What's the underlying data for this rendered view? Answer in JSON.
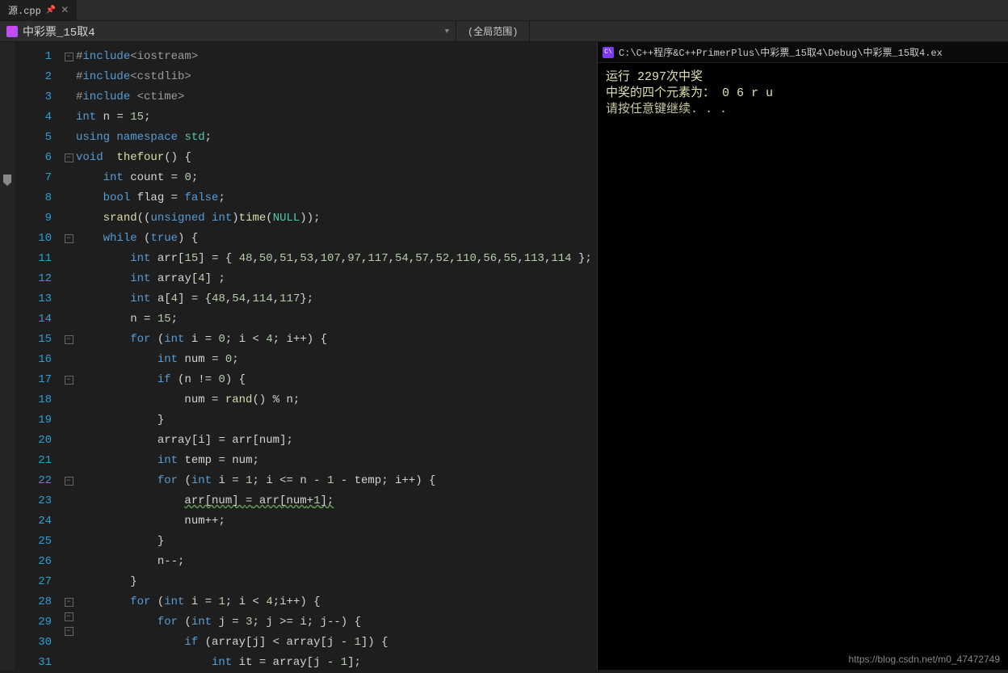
{
  "tab": {
    "label": "源.cpp"
  },
  "toolbar": {
    "project": "中彩票_15取4",
    "scope": "(全局范围)"
  },
  "console": {
    "title": "C:\\C++程序&C++PrimerPlus\\中彩票_15取4\\Debug\\中彩票_15取4.ex",
    "line1": "运行 2297次中奖",
    "line2": "中奖的四个元素为：  0 6 r u",
    "line3": "请按任意键继续. . ."
  },
  "watermark": "https://blog.csdn.net/m0_47472749",
  "gutter": {
    "start": 1,
    "end": 31,
    "highlighted": 15
  },
  "code": [
    {
      "n": 1,
      "fold": "-",
      "t": [
        [
          "pp",
          "#"
        ],
        [
          "ppk",
          "include"
        ],
        [
          "pp",
          "<iostream>"
        ]
      ]
    },
    {
      "n": 2,
      "t": [
        [
          "pp",
          "#"
        ],
        [
          "ppk",
          "include"
        ],
        [
          "pp",
          "<cstdlib>"
        ]
      ]
    },
    {
      "n": 3,
      "t": [
        [
          "pp",
          "#"
        ],
        [
          "ppk",
          "include"
        ],
        [
          "pp",
          " <ctime>"
        ]
      ]
    },
    {
      "n": 4,
      "t": [
        [
          "type",
          "int"
        ],
        [
          "id",
          " n "
        ],
        [
          "op",
          "="
        ],
        [
          "id",
          " "
        ],
        [
          "num",
          "15"
        ],
        [
          "op",
          ";"
        ]
      ]
    },
    {
      "n": 5,
      "t": [
        [
          "kw",
          "using namespace"
        ],
        [
          "id",
          " "
        ],
        [
          "cls",
          "std"
        ],
        [
          "op",
          ";"
        ]
      ]
    },
    {
      "n": 6,
      "fold": "-",
      "t": [
        [
          "type",
          "void"
        ],
        [
          "id",
          "  "
        ],
        [
          "func",
          "thefour"
        ],
        [
          "op",
          "() {"
        ]
      ]
    },
    {
      "n": 7,
      "indent": 1,
      "t": [
        [
          "type",
          "int"
        ],
        [
          "id",
          " count "
        ],
        [
          "op",
          "="
        ],
        [
          "id",
          " "
        ],
        [
          "num",
          "0"
        ],
        [
          "op",
          ";"
        ]
      ]
    },
    {
      "n": 8,
      "indent": 1,
      "t": [
        [
          "type",
          "bool"
        ],
        [
          "id",
          " flag "
        ],
        [
          "op",
          "="
        ],
        [
          "id",
          " "
        ],
        [
          "kw",
          "false"
        ],
        [
          "op",
          ";"
        ]
      ]
    },
    {
      "n": 9,
      "indent": 1,
      "t": [
        [
          "func",
          "srand"
        ],
        [
          "op",
          "(("
        ],
        [
          "type",
          "unsigned int"
        ],
        [
          "op",
          ")"
        ],
        [
          "func",
          "time"
        ],
        [
          "op",
          "("
        ],
        [
          "cls",
          "NULL"
        ],
        [
          "op",
          "));"
        ]
      ]
    },
    {
      "n": 10,
      "fold": "-",
      "indent": 1,
      "t": [
        [
          "kw",
          "while"
        ],
        [
          "op",
          " ("
        ],
        [
          "kw",
          "true"
        ],
        [
          "op",
          ") {"
        ]
      ]
    },
    {
      "n": 11,
      "indent": 2,
      "t": [
        [
          "type",
          "int"
        ],
        [
          "id",
          " arr["
        ],
        [
          "num",
          "15"
        ],
        [
          "id",
          "] "
        ],
        [
          "op",
          "= { "
        ],
        [
          "num",
          "48"
        ],
        [
          "op",
          ","
        ],
        [
          "num",
          "50"
        ],
        [
          "op",
          ","
        ],
        [
          "num",
          "51"
        ],
        [
          "op",
          ","
        ],
        [
          "num",
          "53"
        ],
        [
          "op",
          ","
        ],
        [
          "num",
          "107"
        ],
        [
          "op",
          ","
        ],
        [
          "num",
          "97"
        ],
        [
          "op",
          ","
        ],
        [
          "num",
          "117"
        ],
        [
          "op",
          ","
        ],
        [
          "num",
          "54"
        ],
        [
          "op",
          ","
        ],
        [
          "num",
          "57"
        ],
        [
          "op",
          ","
        ],
        [
          "num",
          "52"
        ],
        [
          "op",
          ","
        ],
        [
          "num",
          "110"
        ],
        [
          "op",
          ","
        ],
        [
          "num",
          "56"
        ],
        [
          "op",
          ","
        ],
        [
          "num",
          "55"
        ],
        [
          "op",
          ","
        ],
        [
          "num",
          "113"
        ],
        [
          "op",
          ","
        ],
        [
          "num",
          "114"
        ],
        [
          "op",
          " };"
        ]
      ]
    },
    {
      "n": 12,
      "indent": 2,
      "t": [
        [
          "type",
          "int"
        ],
        [
          "id",
          " array["
        ],
        [
          "num",
          "4"
        ],
        [
          "id",
          "] ;"
        ]
      ]
    },
    {
      "n": 13,
      "indent": 2,
      "t": [
        [
          "type",
          "int"
        ],
        [
          "id",
          " a["
        ],
        [
          "num",
          "4"
        ],
        [
          "id",
          "] "
        ],
        [
          "op",
          "= {"
        ],
        [
          "num",
          "48"
        ],
        [
          "op",
          ","
        ],
        [
          "num",
          "54"
        ],
        [
          "op",
          ","
        ],
        [
          "num",
          "114"
        ],
        [
          "op",
          ","
        ],
        [
          "num",
          "117"
        ],
        [
          "op",
          "};"
        ]
      ]
    },
    {
      "n": 14,
      "indent": 2,
      "t": [
        [
          "id",
          "n "
        ],
        [
          "op",
          "="
        ],
        [
          "id",
          " "
        ],
        [
          "num",
          "15"
        ],
        [
          "op",
          ";"
        ]
      ]
    },
    {
      "n": 15,
      "fold": "-",
      "indent": 2,
      "hl": true,
      "t": [
        [
          "kw",
          "for"
        ],
        [
          "op",
          " ("
        ],
        [
          "type",
          "int"
        ],
        [
          "id",
          " i "
        ],
        [
          "op",
          "="
        ],
        [
          "id",
          " "
        ],
        [
          "num",
          "0"
        ],
        [
          "op",
          "; i "
        ],
        [
          "op",
          "<"
        ],
        [
          "id",
          " "
        ],
        [
          "num",
          "4"
        ],
        [
          "op",
          "; i"
        ],
        [
          "op",
          "++"
        ],
        [
          "op",
          ") {"
        ]
      ]
    },
    {
      "n": 16,
      "indent": 3,
      "t": [
        [
          "type",
          "int"
        ],
        [
          "id",
          " num "
        ],
        [
          "op",
          "="
        ],
        [
          "id",
          " "
        ],
        [
          "num",
          "0"
        ],
        [
          "op",
          ";"
        ]
      ]
    },
    {
      "n": 17,
      "fold": "-",
      "indent": 3,
      "t": [
        [
          "kw",
          "if"
        ],
        [
          "op",
          " (n "
        ],
        [
          "op",
          "!="
        ],
        [
          "id",
          " "
        ],
        [
          "num",
          "0"
        ],
        [
          "op",
          ") {"
        ]
      ]
    },
    {
      "n": 18,
      "indent": 4,
      "t": [
        [
          "id",
          "num "
        ],
        [
          "op",
          "="
        ],
        [
          "id",
          " "
        ],
        [
          "func",
          "rand"
        ],
        [
          "op",
          "() "
        ],
        [
          "op",
          "%"
        ],
        [
          "id",
          " n;"
        ]
      ]
    },
    {
      "n": 19,
      "indent": 3,
      "t": [
        [
          "op",
          "}"
        ]
      ]
    },
    {
      "n": 20,
      "indent": 3,
      "t": [
        [
          "id",
          "array[i] "
        ],
        [
          "op",
          "="
        ],
        [
          "id",
          " arr[num];"
        ]
      ]
    },
    {
      "n": 21,
      "indent": 3,
      "t": [
        [
          "type",
          "int"
        ],
        [
          "id",
          " temp "
        ],
        [
          "op",
          "="
        ],
        [
          "id",
          " num;"
        ]
      ]
    },
    {
      "n": 22,
      "fold": "-",
      "indent": 3,
      "t": [
        [
          "kw",
          "for"
        ],
        [
          "op",
          " ("
        ],
        [
          "type",
          "int"
        ],
        [
          "id",
          " i "
        ],
        [
          "op",
          "="
        ],
        [
          "id",
          " "
        ],
        [
          "num",
          "1"
        ],
        [
          "op",
          "; i "
        ],
        [
          "op",
          "<="
        ],
        [
          "id",
          " n "
        ],
        [
          "op",
          "-"
        ],
        [
          "id",
          " "
        ],
        [
          "num",
          "1"
        ],
        [
          "id",
          " "
        ],
        [
          "op",
          "-"
        ],
        [
          "id",
          " temp; i"
        ],
        [
          "op",
          "++"
        ],
        [
          "op",
          ") {"
        ]
      ]
    },
    {
      "n": 23,
      "indent": 4,
      "wavy": true,
      "t": [
        [
          "id",
          "arr[num] "
        ],
        [
          "op",
          "="
        ],
        [
          "id",
          " arr[num"
        ],
        [
          "op",
          "+"
        ],
        [
          "num",
          "1"
        ],
        [
          "id",
          "];"
        ]
      ]
    },
    {
      "n": 24,
      "indent": 4,
      "t": [
        [
          "id",
          "num"
        ],
        [
          "op",
          "++;"
        ]
      ]
    },
    {
      "n": 25,
      "indent": 3,
      "t": [
        [
          "op",
          "}"
        ]
      ]
    },
    {
      "n": 26,
      "indent": 3,
      "t": [
        [
          "id",
          "n"
        ],
        [
          "op",
          "--;"
        ]
      ]
    },
    {
      "n": 27,
      "indent": 2,
      "t": [
        [
          "op",
          "}"
        ]
      ]
    },
    {
      "n": 28,
      "fold": "-",
      "indent": 2,
      "t": [
        [
          "kw",
          "for"
        ],
        [
          "op",
          " ("
        ],
        [
          "type",
          "int"
        ],
        [
          "id",
          " i "
        ],
        [
          "op",
          "="
        ],
        [
          "id",
          " "
        ],
        [
          "num",
          "1"
        ],
        [
          "op",
          "; i "
        ],
        [
          "op",
          "<"
        ],
        [
          "id",
          " "
        ],
        [
          "num",
          "4"
        ],
        [
          "op",
          ";i"
        ],
        [
          "op",
          "++"
        ],
        [
          "op",
          ") {"
        ]
      ]
    },
    {
      "n": 29,
      "fold": "-",
      "indent": 3,
      "t": [
        [
          "kw",
          "for"
        ],
        [
          "op",
          " ("
        ],
        [
          "type",
          "int"
        ],
        [
          "id",
          " j "
        ],
        [
          "op",
          "="
        ],
        [
          "id",
          " "
        ],
        [
          "num",
          "3"
        ],
        [
          "op",
          "; j "
        ],
        [
          "op",
          ">="
        ],
        [
          "id",
          " i; j"
        ],
        [
          "op",
          "--"
        ],
        [
          "op",
          ") {"
        ]
      ]
    },
    {
      "n": 30,
      "fold": "-",
      "indent": 4,
      "t": [
        [
          "kw",
          "if"
        ],
        [
          "op",
          " (array[j] "
        ],
        [
          "op",
          "<"
        ],
        [
          "id",
          " array[j "
        ],
        [
          "op",
          "-"
        ],
        [
          "id",
          " "
        ],
        [
          "num",
          "1"
        ],
        [
          "id",
          "]) {"
        ]
      ]
    },
    {
      "n": 31,
      "indent": 5,
      "t": [
        [
          "type",
          "int"
        ],
        [
          "id",
          " it "
        ],
        [
          "op",
          "="
        ],
        [
          "id",
          " array[j "
        ],
        [
          "op",
          "-"
        ],
        [
          "id",
          " "
        ],
        [
          "num",
          "1"
        ],
        [
          "id",
          "];"
        ]
      ]
    }
  ]
}
